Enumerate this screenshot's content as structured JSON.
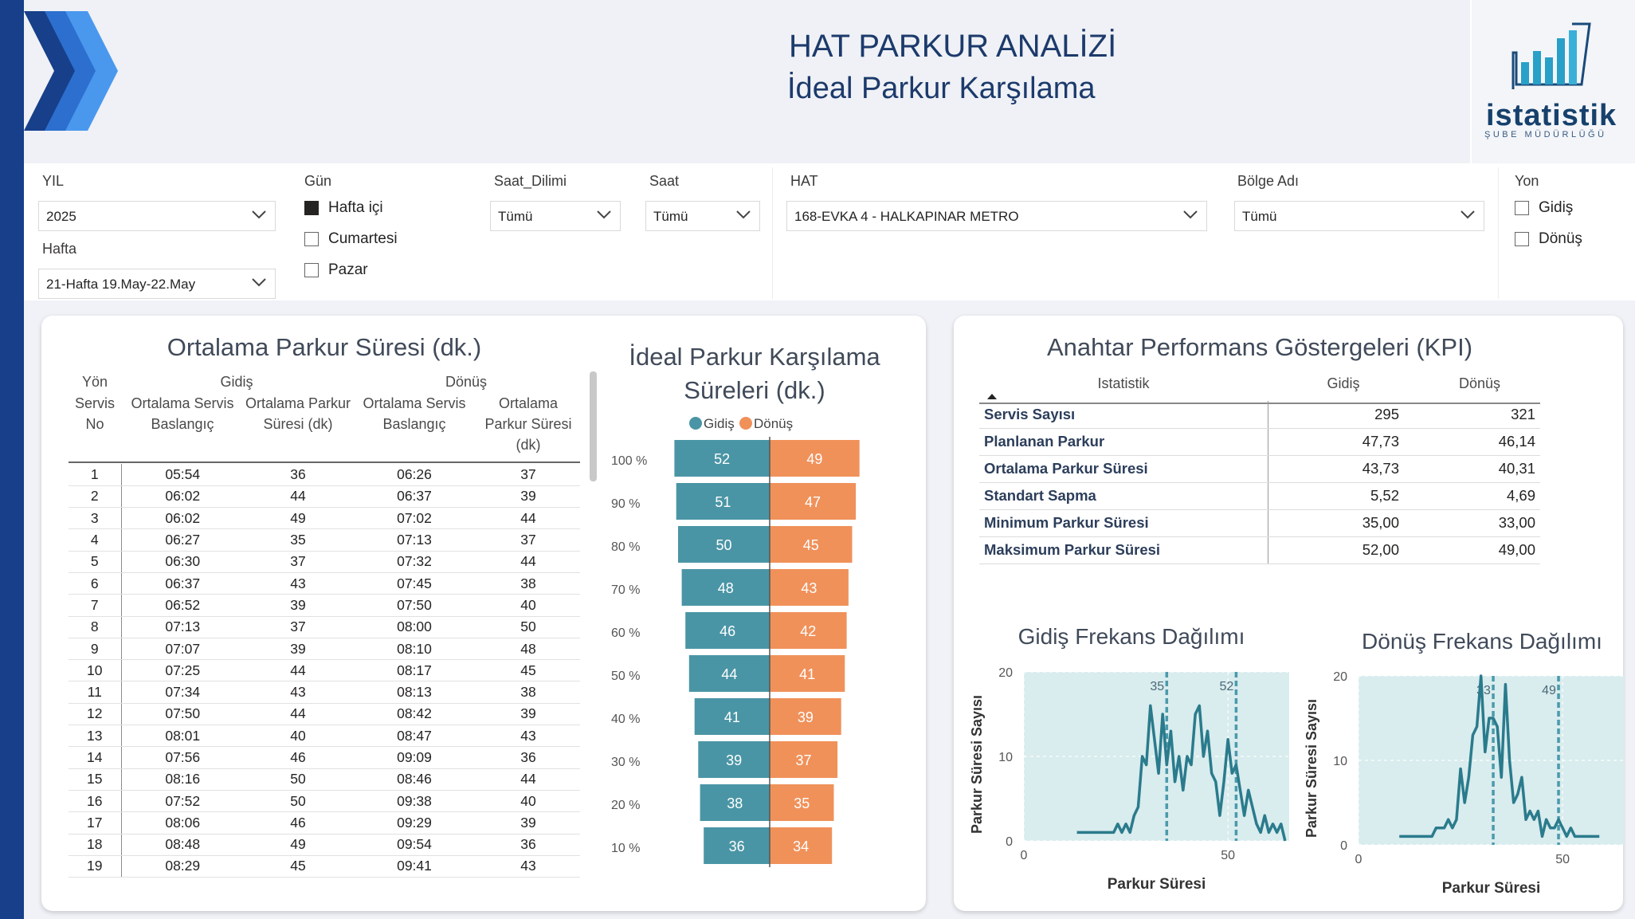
{
  "header": {
    "title": "HAT PARKUR ANALİZİ",
    "subtitle": "İdeal Parkur Karşılama"
  },
  "logo": {
    "name": "istatistik",
    "subname": "ŞUBE MÜDÜRLÜĞÜ"
  },
  "filters": {
    "yil": {
      "label": "YIL",
      "value": "2025"
    },
    "hafta": {
      "label": "Hafta",
      "value": "21-Hafta 19.May-22.May"
    },
    "gun": {
      "label": "Gün",
      "options": [
        {
          "label": "Hafta içi",
          "checked": true
        },
        {
          "label": "Cumartesi",
          "checked": false
        },
        {
          "label": "Pazar",
          "checked": false
        }
      ]
    },
    "saat_dilimi": {
      "label": "Saat_Dilimi",
      "value": "Tümü"
    },
    "saat": {
      "label": "Saat",
      "value": "Tümü"
    },
    "hat": {
      "label": "HAT",
      "value": "168-EVKA 4 - HALKAPINAR METRO"
    },
    "bolge": {
      "label": "Bölge Adı",
      "value": "Tümü"
    },
    "yon": {
      "label": "Yon",
      "options": [
        {
          "label": "Gidiş",
          "checked": false
        },
        {
          "label": "Dönüş",
          "checked": false
        }
      ]
    }
  },
  "parkur_table": {
    "title": "Ortalama Parkur Süresi (dk.)",
    "group_label": "Yön",
    "group_gidis": "Gidiş",
    "group_donus": "Dönüş",
    "col_no": "Servis No",
    "col_start": "Ortalama Servis Baslangıç",
    "col_dur": "Ortalama Parkur Süresi (dk)",
    "rows": [
      [
        "1",
        "05:54",
        "36",
        "06:26",
        "37"
      ],
      [
        "2",
        "06:02",
        "44",
        "06:37",
        "39"
      ],
      [
        "3",
        "06:02",
        "49",
        "07:02",
        "44"
      ],
      [
        "4",
        "06:27",
        "35",
        "07:13",
        "37"
      ],
      [
        "5",
        "06:30",
        "37",
        "07:32",
        "44"
      ],
      [
        "6",
        "06:37",
        "43",
        "07:45",
        "38"
      ],
      [
        "7",
        "06:52",
        "39",
        "07:50",
        "40"
      ],
      [
        "8",
        "07:13",
        "37",
        "08:00",
        "50"
      ],
      [
        "9",
        "07:07",
        "39",
        "08:10",
        "48"
      ],
      [
        "10",
        "07:25",
        "44",
        "08:17",
        "45"
      ],
      [
        "11",
        "07:34",
        "43",
        "08:13",
        "38"
      ],
      [
        "12",
        "07:50",
        "44",
        "08:42",
        "39"
      ],
      [
        "13",
        "08:01",
        "40",
        "08:47",
        "43"
      ],
      [
        "14",
        "07:56",
        "46",
        "09:09",
        "36"
      ],
      [
        "15",
        "08:16",
        "50",
        "08:46",
        "44"
      ],
      [
        "16",
        "07:52",
        "50",
        "09:38",
        "40"
      ],
      [
        "17",
        "08:06",
        "46",
        "09:29",
        "39"
      ],
      [
        "18",
        "08:48",
        "49",
        "09:54",
        "36"
      ],
      [
        "19",
        "08:29",
        "45",
        "09:41",
        "43"
      ]
    ]
  },
  "kpi": {
    "title": "Anahtar Performans Göstergeleri (KPI)",
    "col_stat": "Istatistik",
    "col_gidis": "Gidiş",
    "col_donus": "Dönüş",
    "rows": [
      [
        "Servis Sayısı",
        "295",
        "321"
      ],
      [
        "Planlanan Parkur",
        "47,73",
        "46,14"
      ],
      [
        "Ortalama Parkur Süresi",
        "43,73",
        "40,31"
      ],
      [
        "Standart Sapma",
        "5,52",
        "4,69"
      ],
      [
        "Minimum Parkur Süresi",
        "35,00",
        "33,00"
      ],
      [
        "Maksimum Parkur Süresi",
        "52,00",
        "49,00"
      ]
    ]
  },
  "colors": {
    "gidis": "#4a95a5",
    "donus": "#f0915a",
    "line": "#2a7b8c",
    "histbg": "#d9ecee"
  },
  "chart_data": [
    {
      "type": "bar",
      "title": "İdeal Parkur Karşılama Süreleri (dk.)",
      "categories": [
        "100 %",
        "90 %",
        "80 %",
        "70 %",
        "60 %",
        "50 %",
        "40 %",
        "30 %",
        "20 %",
        "10 %"
      ],
      "series": [
        {
          "name": "Gidiş",
          "values": [
            52,
            51,
            50,
            48,
            46,
            44,
            41,
            39,
            38,
            36
          ]
        },
        {
          "name": "Dönüş",
          "values": [
            49,
            47,
            45,
            43,
            42,
            41,
            39,
            37,
            35,
            34
          ]
        }
      ],
      "legend": "top"
    },
    {
      "type": "line",
      "title": "Gidiş Frekans Dağılımı",
      "xlabel": "Parkur Süresi",
      "ylabel": "Parkur Süresi Sayısı",
      "xlim": [
        0,
        65
      ],
      "ylim": [
        0,
        20
      ],
      "xticks": [
        "0",
        "50"
      ],
      "yticks": [
        "0",
        "10",
        "20"
      ],
      "ref_lines": [
        "35",
        "52"
      ],
      "x": [
        13,
        14,
        15,
        16,
        17,
        18,
        19,
        20,
        21,
        22,
        23,
        24,
        25,
        26,
        27,
        28,
        29,
        30,
        31,
        32,
        33,
        34,
        35,
        36,
        37,
        38,
        39,
        40,
        41,
        42,
        43,
        44,
        45,
        46,
        47,
        48,
        49,
        50,
        51,
        52,
        53,
        54,
        55,
        56,
        57,
        58,
        59,
        60,
        61,
        62,
        63,
        64
      ],
      "values": [
        1,
        1,
        1,
        1,
        1,
        1,
        1,
        1,
        1,
        1,
        2,
        1,
        2,
        1,
        3,
        4,
        10,
        9,
        16,
        12,
        8,
        15,
        9,
        13,
        7,
        10,
        6,
        10,
        9,
        15,
        16,
        10,
        13,
        8,
        7,
        3,
        7,
        12,
        8,
        9,
        6,
        3,
        6,
        4,
        2,
        1,
        3,
        1,
        2,
        1,
        2,
        0
      ]
    },
    {
      "type": "line",
      "title": "Dönüş Frekans Dağılımı",
      "xlabel": "Parkur Süresi",
      "ylabel": "Parkur Süresi Sayısı",
      "xlim": [
        0,
        65
      ],
      "ylim": [
        0,
        20
      ],
      "xticks": [
        "0",
        "50"
      ],
      "yticks": [
        "0",
        "10",
        "20"
      ],
      "ref_lines": [
        "33",
        "49"
      ],
      "x": [
        10,
        11,
        12,
        13,
        14,
        15,
        16,
        17,
        18,
        19,
        20,
        21,
        22,
        23,
        24,
        25,
        26,
        27,
        28,
        29,
        30,
        31,
        32,
        33,
        34,
        35,
        36,
        37,
        38,
        39,
        40,
        41,
        42,
        43,
        44,
        45,
        46,
        47,
        48,
        49,
        50,
        51,
        52,
        53,
        54,
        55,
        56,
        57,
        58,
        59
      ],
      "values": [
        1,
        1,
        1,
        1,
        1,
        1,
        1,
        1,
        1,
        2,
        2,
        2,
        3,
        2,
        3,
        9,
        5,
        8,
        13,
        14,
        20,
        11,
        15,
        15,
        14,
        8,
        19,
        10,
        5,
        6,
        8,
        3,
        4,
        3,
        4,
        1,
        3,
        2,
        2,
        3,
        2,
        1,
        2,
        1,
        1,
        1,
        1,
        1,
        1,
        1
      ]
    }
  ]
}
